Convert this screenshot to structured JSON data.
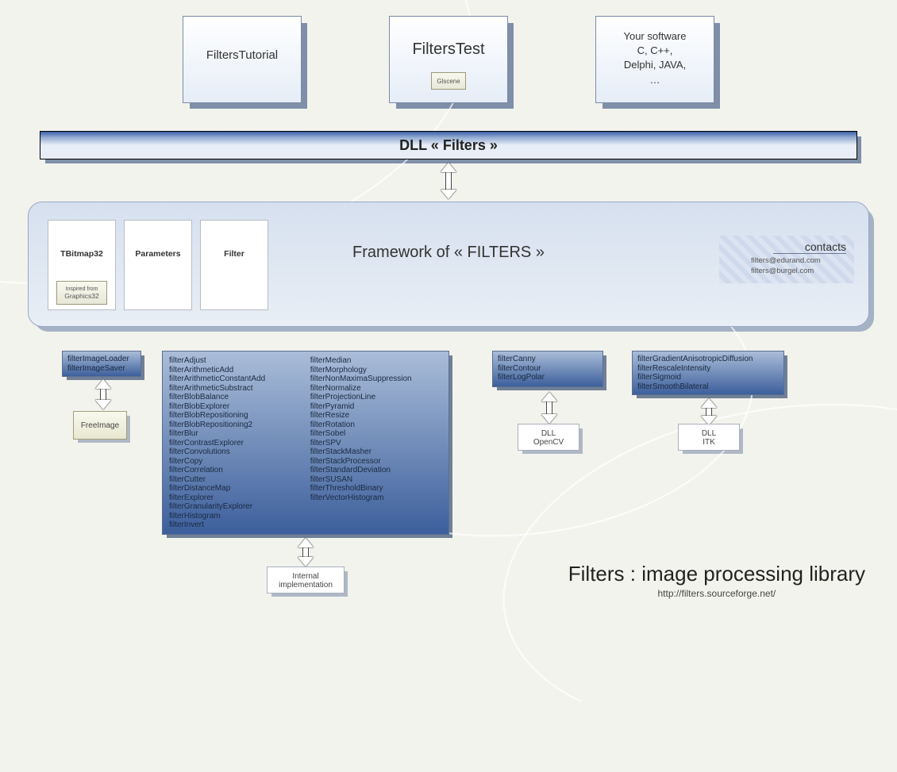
{
  "top": {
    "box1": "FiltersTutorial",
    "box2": "FiltersTest",
    "box2chip": "Glscene",
    "box3line1": "Your software",
    "box3line2": "C, C++,",
    "box3line3": "Delphi, JAVA,",
    "box3line4": "…"
  },
  "dll_bar": "DLL « Filters »",
  "framework": {
    "title": "Framework of « FILTERS »",
    "card1": "TBitmap32",
    "card1sub1": "Inspired from",
    "card1sub2": "Graphics32",
    "card2": "Parameters",
    "card3": "Filter",
    "contacts_title": "contacts",
    "contacts_email1": "filters@edurand.com",
    "contacts_email2": "filters@burgel.com"
  },
  "loader_box": {
    "l1": "filterImageLoader",
    "l2": "filterImageSaver"
  },
  "freeimage": "FreeImage",
  "bigbox": {
    "col1": [
      "filterAdjust",
      "filterArithmeticAdd",
      "filterArithmeticConstantAdd",
      "filterArithmeticSubstract",
      "filterBlobBalance",
      "filterBlobExplorer",
      "filterBlobRepositioning",
      "filterBlobRepositioning2",
      "filterBlur",
      "filterContrastExplorer",
      "filterConvolutions",
      "filterCopy",
      "filterCorrelation",
      "filterCutter",
      "filterDistanceMap",
      "filterExplorer",
      "filterGranularityExplorer",
      "filterHistogram",
      "filterInvert"
    ],
    "col2": [
      "filterMedian",
      "filterMorphology",
      "filterNonMaximaSuppression",
      "filterNormalize",
      "filterProjectionLine",
      "filterPyramid",
      "filterResize",
      "filterRotation",
      "filterSobel",
      "filterSPV",
      "filterStackMasher",
      "filterStackProcessor",
      "filterStandardDeviation",
      "filterSUSAN",
      "filterThresholdBinary",
      "filterVectorHistogram"
    ]
  },
  "internal": {
    "l1": "Internal",
    "l2": "implementation"
  },
  "cannybox": {
    "l1": "filterCanny",
    "l2": "filterContour",
    "l3": "filterLogPolar"
  },
  "dll_opencv": {
    "l1": "DLL",
    "l2": "OpenCV"
  },
  "gradbox": {
    "l1": "filterGradientAnisotropicDiffusion",
    "l2": "filterRescaleIntensity",
    "l3": "filterSigmoid",
    "l4": "filterSmoothBilateral"
  },
  "dll_itk": {
    "l1": "DLL",
    "l2": "ITK"
  },
  "title": {
    "big": "Filters : image processing library",
    "url": "http://filters.sourceforge.net/"
  }
}
